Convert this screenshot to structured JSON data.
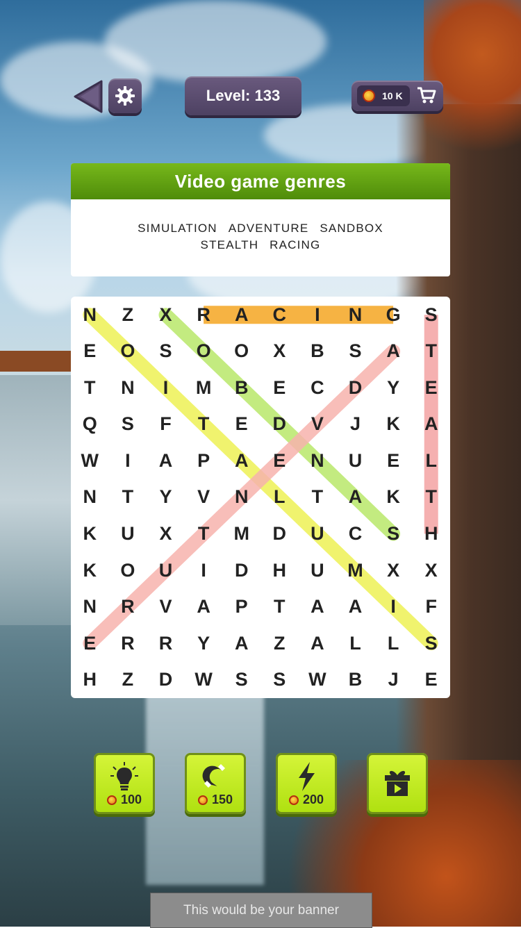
{
  "header": {
    "level_label": "Level: 133",
    "coins": "10 K"
  },
  "puzzle": {
    "category": "Video game genres",
    "words": [
      "SIMULATION",
      "ADVENTURE",
      "SANDBOX",
      "STEALTH",
      "RACING"
    ],
    "grid": [
      "NZXRACINGS",
      "EOSOOXBSAT",
      "TNIMBECDYE",
      "QSFTEDVJKA",
      "WIAPAENUEL",
      "NTYVNLTAKT",
      "KUXTMDUCSH",
      "KOUIDHUMXX",
      "NRVAPTAAIF",
      "ERRYAZALLS",
      "HZDWSSWBJE"
    ],
    "found_highlights": [
      {
        "word": "RACING",
        "color": "#f5a623"
      },
      {
        "word": "STEALTH",
        "color": "#f4a3a3"
      },
      {
        "word": "SIMULATION",
        "color": "#eef255"
      },
      {
        "word": "SANDBOX",
        "color": "#b9e86b"
      },
      {
        "word": "ADVENTURE",
        "color": "#f7b3ad"
      }
    ]
  },
  "boosters": [
    {
      "icon": "lightbulb-icon",
      "cost": "100"
    },
    {
      "icon": "magnet-icon",
      "cost": "150"
    },
    {
      "icon": "lightning-icon",
      "cost": "200"
    },
    {
      "icon": "gift-video-icon",
      "cost": ""
    }
  ],
  "banner": {
    "text": "This would be your banner"
  }
}
